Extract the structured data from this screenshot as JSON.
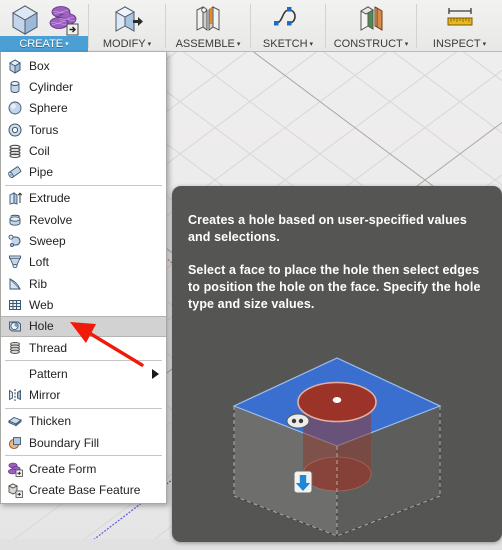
{
  "app": {
    "name": "Fusion 360 CREATE menu with Hole tooltip"
  },
  "ribbon": {
    "tabs": [
      {
        "label": "CREATE",
        "caret": "▾",
        "active": true,
        "icon": "box-icon",
        "icon2": "create-form-icon"
      },
      {
        "label": "MODIFY",
        "caret": "▾",
        "active": false,
        "icon": "press-pull-icon",
        "icon2": ""
      },
      {
        "label": "ASSEMBLE",
        "caret": "▾",
        "active": false,
        "icon": "joint-icon",
        "icon2": ""
      },
      {
        "label": "SKETCH",
        "caret": "▾",
        "active": false,
        "icon": "spline-icon",
        "icon2": ""
      },
      {
        "label": "CONSTRUCT",
        "caret": "▾",
        "active": false,
        "icon": "plane-icon",
        "icon2": ""
      },
      {
        "label": "INSPECT",
        "caret": "▾",
        "active": false,
        "icon": "measure-icon",
        "icon2": ""
      }
    ]
  },
  "menu": {
    "items": [
      {
        "label": "Box",
        "icon": "box-icon",
        "type": "item"
      },
      {
        "label": "Cylinder",
        "icon": "cylinder-icon",
        "type": "item"
      },
      {
        "label": "Sphere",
        "icon": "sphere-icon",
        "type": "item"
      },
      {
        "label": "Torus",
        "icon": "torus-icon",
        "type": "item"
      },
      {
        "label": "Coil",
        "icon": "coil-icon",
        "type": "item"
      },
      {
        "label": "Pipe",
        "icon": "pipe-icon",
        "type": "item"
      },
      {
        "label": "",
        "icon": "",
        "type": "separator"
      },
      {
        "label": "Extrude",
        "icon": "extrude-icon",
        "type": "item"
      },
      {
        "label": "Revolve",
        "icon": "revolve-icon",
        "type": "item"
      },
      {
        "label": "Sweep",
        "icon": "sweep-icon",
        "type": "item"
      },
      {
        "label": "Loft",
        "icon": "loft-icon",
        "type": "item"
      },
      {
        "label": "Rib",
        "icon": "rib-icon",
        "type": "item"
      },
      {
        "label": "Web",
        "icon": "web-icon",
        "type": "item"
      },
      {
        "label": "Hole",
        "icon": "hole-icon",
        "type": "item",
        "highlighted": true
      },
      {
        "label": "Thread",
        "icon": "thread-icon",
        "type": "item"
      },
      {
        "label": "",
        "icon": "",
        "type": "separator"
      },
      {
        "label": "Pattern",
        "icon": "",
        "type": "submenu",
        "arrow": "▶"
      },
      {
        "label": "Mirror",
        "icon": "mirror-icon",
        "type": "item"
      },
      {
        "label": "",
        "icon": "",
        "type": "separator"
      },
      {
        "label": "Thicken",
        "icon": "thicken-icon",
        "type": "item"
      },
      {
        "label": "Boundary Fill",
        "icon": "boundary-fill-icon",
        "type": "item"
      },
      {
        "label": "",
        "icon": "",
        "type": "separator"
      },
      {
        "label": "Create Form",
        "icon": "create-form-icon",
        "type": "item"
      },
      {
        "label": "Create Base Feature",
        "icon": "create-base-feature-icon",
        "type": "item"
      }
    ]
  },
  "viewport_toolbar": {
    "collapse_label": "−"
  },
  "tooltip": {
    "paragraph1": "Creates a hole based on user-specified values and selections.",
    "paragraph2": "Select a face to place the hole then select edges to position the hole on the face. Specify the hole type and size values.",
    "illustration": "hole-feature-cube-illustration"
  },
  "annotation": {
    "arrow": "red-pointer-arrow"
  },
  "colors": {
    "accent": "#4a9fd4",
    "tooltip_bg": "#555553",
    "menu_bg": "#ffffff",
    "highlight_bg": "#d2d2d2",
    "annotation_red": "#f01a0a",
    "viewport_bg": "#edecec",
    "face_blue": "#3a6fd0",
    "hole_red": "#9c3328",
    "x_axis_red": "#e86a6a",
    "z_axis_blue": "#5050d8"
  }
}
